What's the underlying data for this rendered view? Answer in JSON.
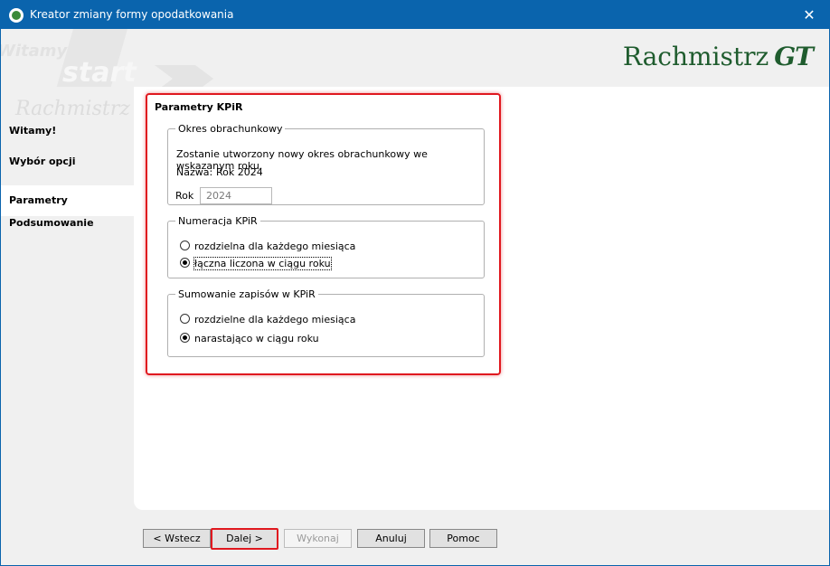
{
  "window": {
    "title": "Kreator zmiany formy opodatkowania"
  },
  "header": {
    "logo_text": "Rachmistrz",
    "logo_gt": "GT",
    "deco_words": [
      "Witamy",
      "start"
    ]
  },
  "leftnav": {
    "ghost_text": "Rachmistrz",
    "items": [
      {
        "label": "Witamy!"
      },
      {
        "label": "Wybór opcji"
      },
      {
        "label": "Parametry",
        "active": true
      },
      {
        "label": "Podsumowanie"
      }
    ]
  },
  "section": {
    "title": "Parametry KPiR",
    "okres": {
      "legend": "Okres obrachunkowy",
      "info": "Zostanie utworzony nowy okres obrachunkowy we wskazanym roku.",
      "name_label": "Nazwa:",
      "name_value": "Rok 2024",
      "year_label": "Rok",
      "year_value": "2024"
    },
    "numeracja": {
      "legend": "Numeracja KPiR",
      "options": [
        {
          "label": "rozdzielna dla każdego miesiąca",
          "checked": false
        },
        {
          "label": "łączna liczona w ciągu roku",
          "checked": true
        }
      ]
    },
    "sumowanie": {
      "legend": "Sumowanie zapisów w KPiR",
      "options": [
        {
          "label": "rozdzielne dla każdego miesiąca",
          "checked": false
        },
        {
          "label": "narastająco w ciągu roku",
          "checked": true
        }
      ]
    }
  },
  "buttons": {
    "back": "< Wstecz",
    "next": "Dalej >",
    "execute": "Wykonaj",
    "cancel": "Anuluj",
    "help": "Pomoc"
  },
  "colors": {
    "titlebar": "#0a64ad",
    "highlight": "#e0181f",
    "logo": "#1f5c2e"
  }
}
